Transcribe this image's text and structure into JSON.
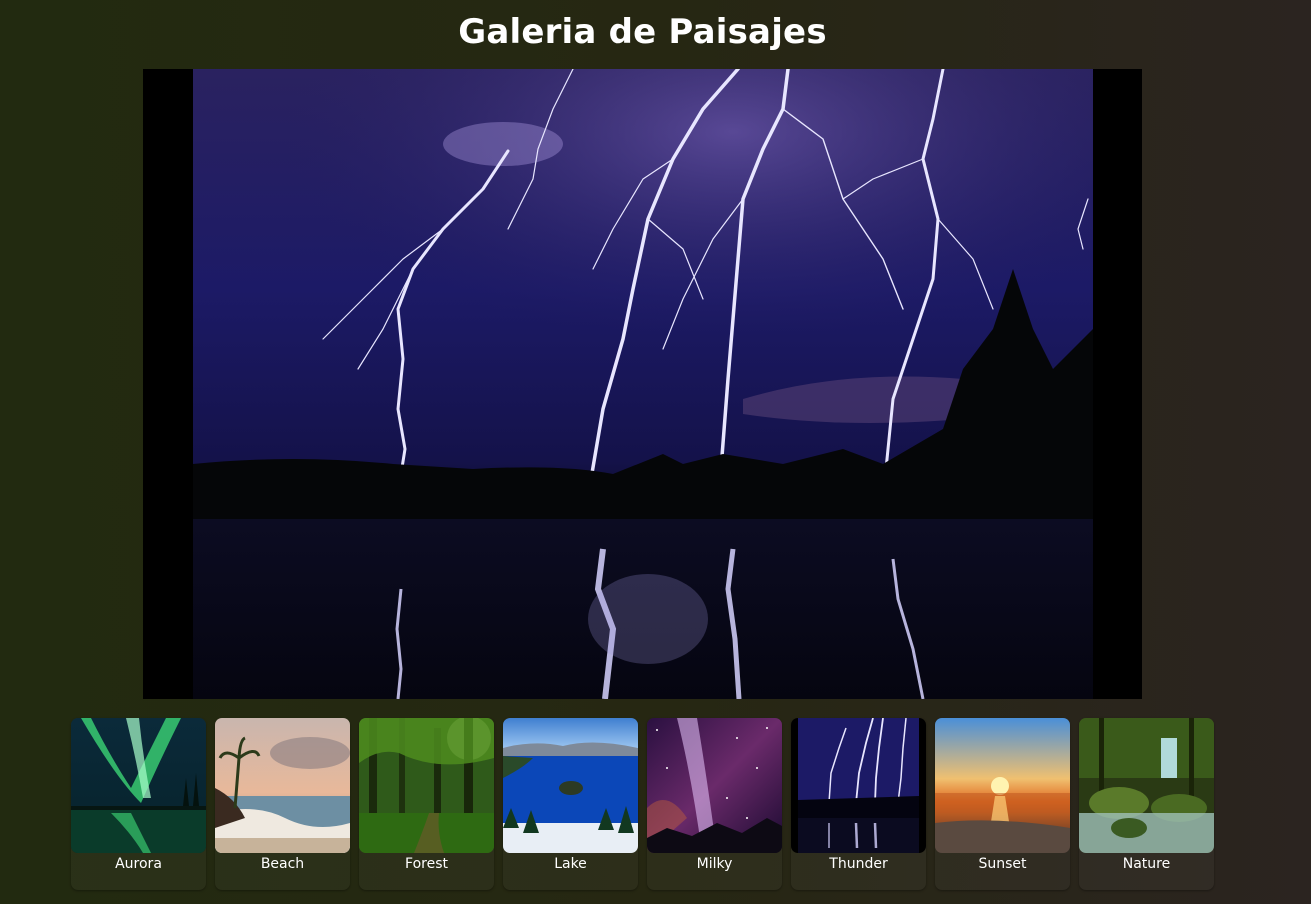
{
  "page": {
    "title": "Galeria de Paisajes"
  },
  "main_image": {
    "subject": "thunder"
  },
  "gallery": {
    "selected": "Thunder",
    "items": [
      {
        "label": "Aurora"
      },
      {
        "label": "Beach"
      },
      {
        "label": "Forest"
      },
      {
        "label": "Lake"
      },
      {
        "label": "Milky"
      },
      {
        "label": "Thunder"
      },
      {
        "label": "Sunset"
      },
      {
        "label": "Nature"
      }
    ]
  },
  "colors": {
    "background_left": "#222a10",
    "background_right": "#2b2420",
    "title_text": "#ffffff",
    "frame_border": "#000000"
  }
}
